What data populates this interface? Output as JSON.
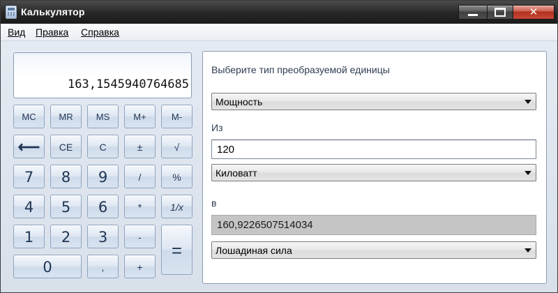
{
  "window": {
    "title": "Калькулятор",
    "minimize_label": "",
    "maximize_label": "",
    "close_label": "✕"
  },
  "menu": {
    "items": [
      {
        "label": "Вид"
      },
      {
        "label": "Правка"
      },
      {
        "label": "Справка"
      }
    ]
  },
  "calculator": {
    "display": "163,1545940764685",
    "keys": {
      "mc": "MC",
      "mr": "MR",
      "ms": "MS",
      "mplus": "M+",
      "mminus": "M-",
      "back": "⟵",
      "ce": "CE",
      "c": "C",
      "plusminus": "±",
      "sqrt": "√",
      "seven": "7",
      "eight": "8",
      "nine": "9",
      "divide": "/",
      "percent": "%",
      "four": "4",
      "five": "5",
      "six": "6",
      "multiply": "*",
      "reciprocal": "1/x",
      "one": "1",
      "two": "2",
      "three": "3",
      "minus": "-",
      "equals": "=",
      "zero": "0",
      "decimal": ",",
      "plus": "+"
    }
  },
  "converter": {
    "heading": "Выберите тип преобразуемой единицы",
    "type_selected": "Мощность",
    "from_label": "Из",
    "from_value": "120",
    "from_unit": "Киловатт",
    "to_label": "в",
    "to_value": "160,9226507514034",
    "to_unit": "Лошадиная сила"
  },
  "icons": {
    "app": "calculator-icon",
    "minimize": "minimize-icon",
    "maximize": "maximize-icon",
    "close": "close-icon",
    "dropdown": "chevron-down-icon"
  },
  "colors": {
    "titlebar": "#262626",
    "close_button": "#c84737",
    "background": "#dde4ee",
    "key_border": "#8ea3c0",
    "key_text": "#1f3552",
    "result_bg": "#c5c5c5"
  }
}
